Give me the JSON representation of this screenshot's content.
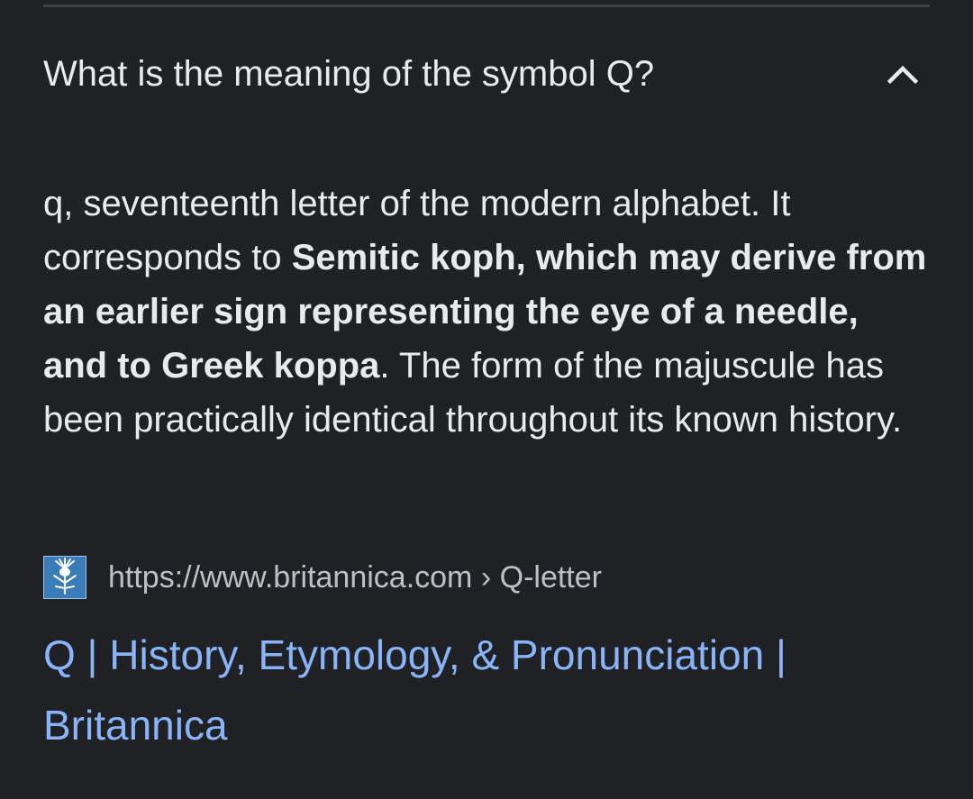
{
  "faq": {
    "question": "What is the meaning of the symbol Q?",
    "expanded_icon": "chevron-up-icon"
  },
  "answer": {
    "part1": "q, seventeenth letter of the modern alphabet. It corresponds to ",
    "bold": "Semitic koph, which may derive from an earlier sign representing the eye of a needle, and to Greek koppa",
    "part2": ". The form of the majuscule has been practically identical throughout its known history."
  },
  "source": {
    "favicon": "britannica-thistle-icon",
    "url": "https://www.britannica.com",
    "separator": "›",
    "path": "Q-letter"
  },
  "result": {
    "title": "Q | History, Etymology, & Pronunciation | Britannica"
  },
  "colors": {
    "background": "#202124",
    "text": "#e8eaed",
    "secondary_text": "#bdc1c6",
    "link": "#8ab4f8",
    "favicon_bg": "#3a7cb8"
  }
}
